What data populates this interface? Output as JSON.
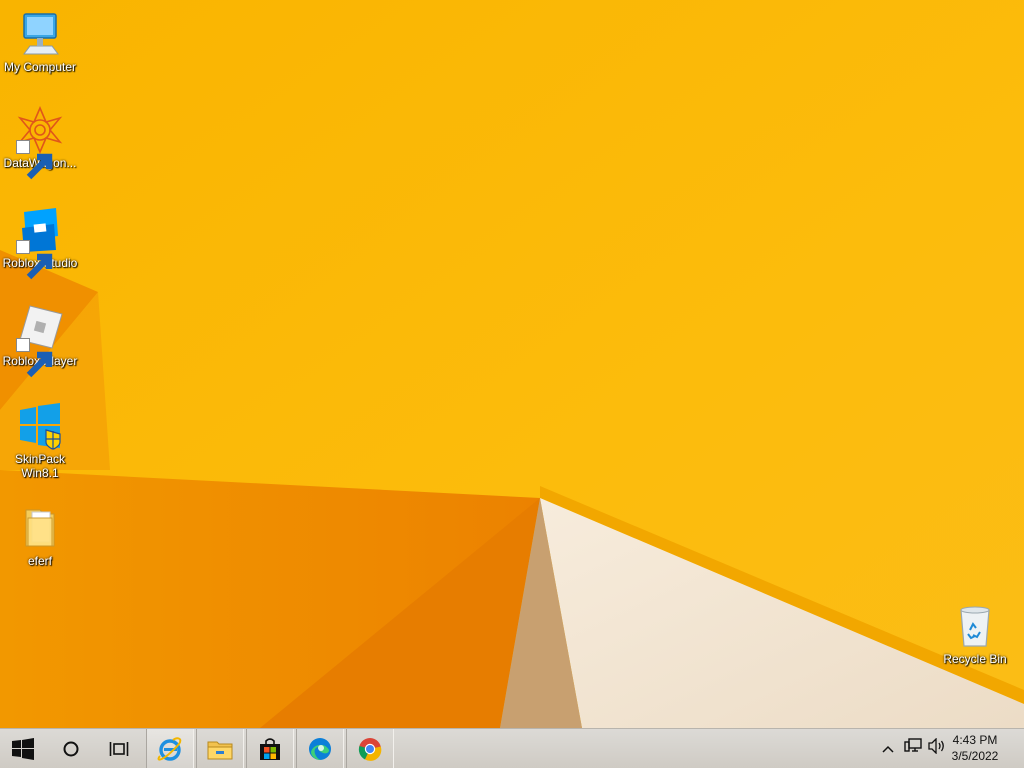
{
  "desktop": {
    "icons": [
      {
        "label": "My Computer",
        "icon": "my-computer-icon"
      },
      {
        "label": "DataWagon...",
        "icon": "datawagon-icon"
      },
      {
        "label": "Roblox Studio",
        "icon": "roblox-studio-icon"
      },
      {
        "label": "Roblox Player",
        "icon": "roblox-player-icon"
      },
      {
        "label": "SkinPack Win8.1",
        "icon": "skinpack-icon"
      },
      {
        "label": "eferf",
        "icon": "folder-icon"
      }
    ],
    "recycle_bin": {
      "label": "Recycle Bin",
      "icon": "recycle-bin-icon"
    }
  },
  "taskbar": {
    "buttons": [
      {
        "name": "start-button",
        "icon": "windows-logo-icon"
      },
      {
        "name": "search-button",
        "icon": "search-circle-icon"
      },
      {
        "name": "task-view-button",
        "icon": "task-view-icon"
      },
      {
        "name": "internet-explorer-button",
        "icon": "internet-explorer-icon"
      },
      {
        "name": "file-explorer-button",
        "icon": "file-explorer-icon"
      },
      {
        "name": "store-button",
        "icon": "store-icon"
      },
      {
        "name": "edge-button",
        "icon": "edge-icon"
      },
      {
        "name": "chrome-button",
        "icon": "chrome-icon"
      }
    ],
    "tray": {
      "icons": [
        "chevron-up-icon",
        "network-icon",
        "volume-icon"
      ],
      "time": "4:43 PM",
      "date": "3/5/2022"
    }
  },
  "colors": {
    "wallpaper_base": "#f8b000",
    "wallpaper_orange": "#f08c00",
    "wallpaper_cream": "#f3e7d6",
    "taskbar": "#d4d0c8"
  }
}
